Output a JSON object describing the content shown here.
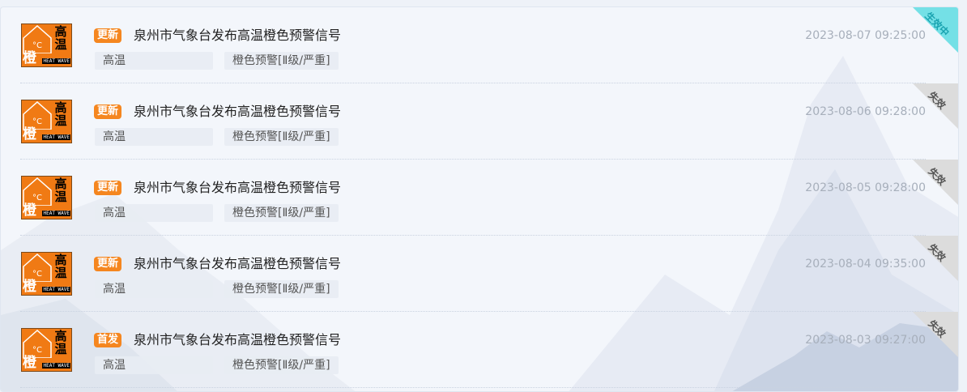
{
  "colors": {
    "badge_bg": "#f5861f",
    "icon_orange": "#f07a14",
    "ribbon_active": "#74e0e6",
    "ribbon_active_text": "#1aa3b0",
    "ribbon_expired": "#dcdcdc",
    "ribbon_expired_text": "#555555"
  },
  "items": [
    {
      "icon": {
        "name": "orange-heat-wave-warning-icon",
        "level": "橙",
        "type": "高温",
        "en": "HEAT WAVE",
        "unit": "°C"
      },
      "badge": "更新",
      "title": "泉州市气象台发布高温橙色预警信号",
      "category": "高温",
      "level_text": "橙色预警[Ⅱ级/严重]",
      "time": "2023-08-07 09:25:00",
      "status": "生效中",
      "status_type": "active"
    },
    {
      "icon": {
        "name": "orange-heat-wave-warning-icon",
        "level": "橙",
        "type": "高温",
        "en": "HEAT WAVE",
        "unit": "°C"
      },
      "badge": "更新",
      "title": "泉州市气象台发布高温橙色预警信号",
      "category": "高温",
      "level_text": "橙色预警[Ⅱ级/严重]",
      "time": "2023-08-06 09:28:00",
      "status": "失效",
      "status_type": "expired"
    },
    {
      "icon": {
        "name": "orange-heat-wave-warning-icon",
        "level": "橙",
        "type": "高温",
        "en": "HEAT WAVE",
        "unit": "°C"
      },
      "badge": "更新",
      "title": "泉州市气象台发布高温橙色预警信号",
      "category": "高温",
      "level_text": "橙色预警[Ⅱ级/严重]",
      "time": "2023-08-05 09:28:00",
      "status": "失效",
      "status_type": "expired"
    },
    {
      "icon": {
        "name": "orange-heat-wave-warning-icon",
        "level": "橙",
        "type": "高温",
        "en": "HEAT WAVE",
        "unit": "°C"
      },
      "badge": "更新",
      "title": "泉州市气象台发布高温橙色预警信号",
      "category": "高温",
      "level_text": "橙色预警[Ⅱ级/严重]",
      "time": "2023-08-04 09:35:00",
      "status": "失效",
      "status_type": "expired"
    },
    {
      "icon": {
        "name": "orange-heat-wave-warning-icon",
        "level": "橙",
        "type": "高温",
        "en": "HEAT WAVE",
        "unit": "°C"
      },
      "badge": "首发",
      "title": "泉州市气象台发布高温橙色预警信号",
      "category": "高温",
      "level_text": "橙色预警[Ⅱ级/严重]",
      "time": "2023-08-03 09:27:00",
      "status": "失效",
      "status_type": "expired"
    }
  ]
}
